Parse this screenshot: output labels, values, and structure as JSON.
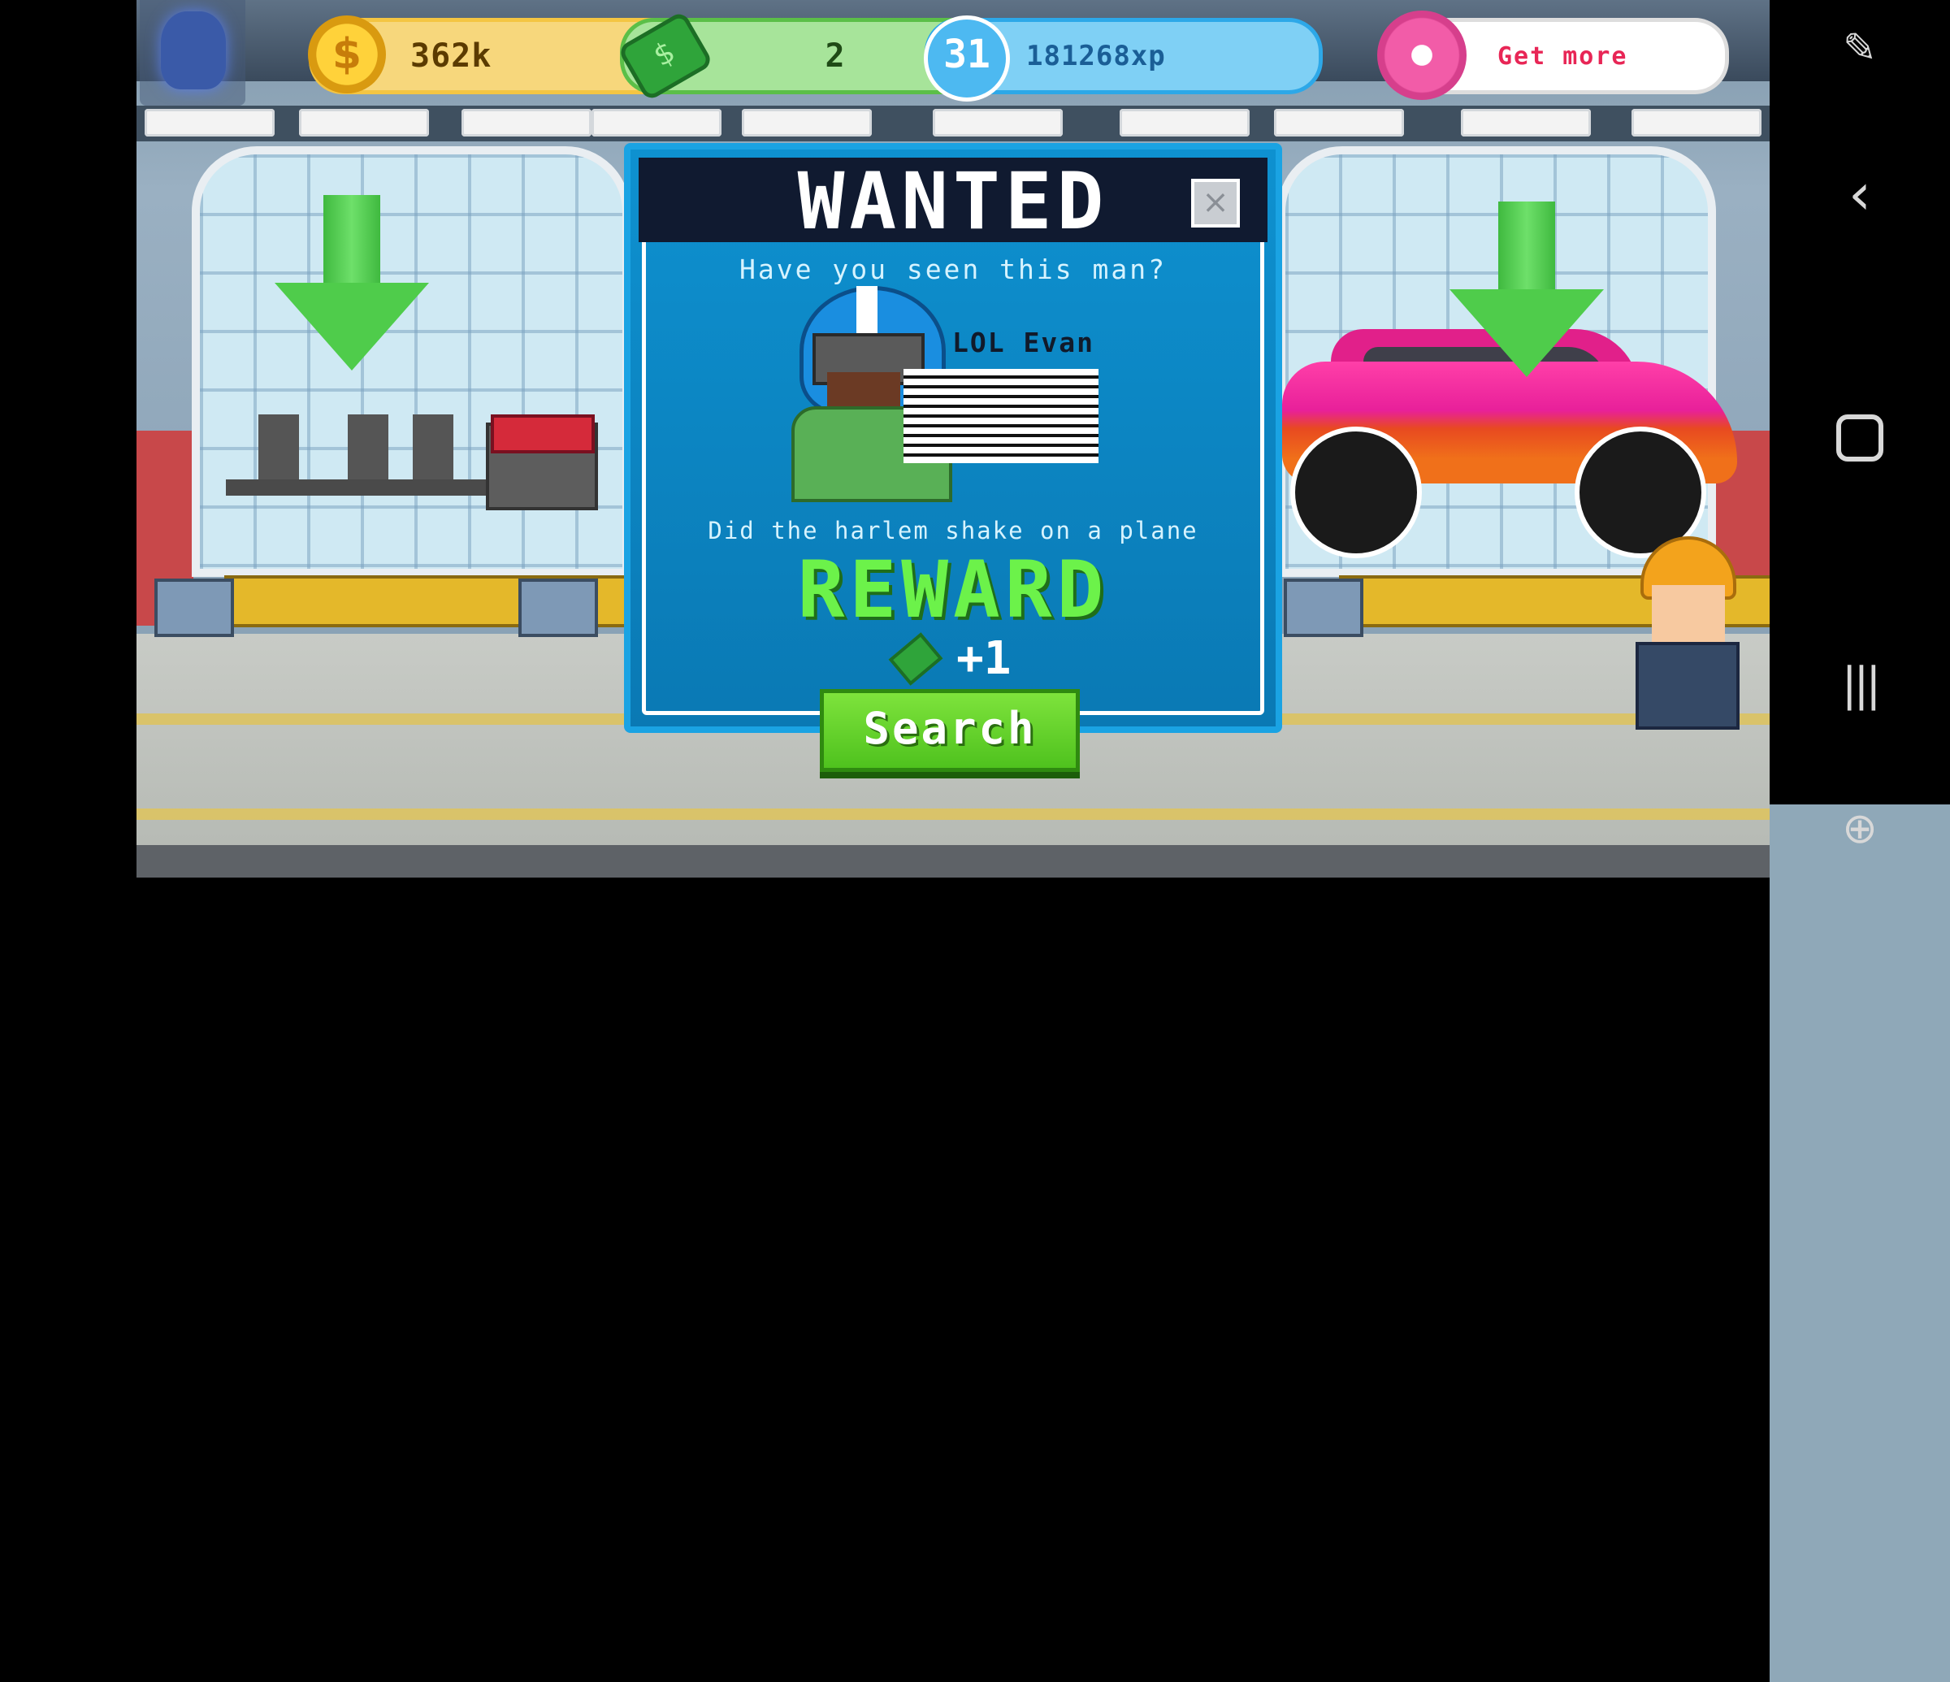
{
  "hud": {
    "coins": "362k",
    "cash": "2",
    "level": "31",
    "xp": "181268xp",
    "donut_label": "Get more"
  },
  "wanted": {
    "title": "WANTED",
    "close": "×",
    "question": "Have you seen this man?",
    "name": "LOL Evan",
    "crime": "Did the harlem shake on a plane",
    "reward_title": "REWARD",
    "reward_amount": "+1",
    "search_label": "Search"
  },
  "icons": {
    "coin": "$",
    "plus": "+",
    "cash": "$",
    "assist": "assistant-icon",
    "back": "back-icon",
    "home": "home-icon",
    "recents": "recents-icon",
    "game_tools": "game-tools-icon"
  }
}
